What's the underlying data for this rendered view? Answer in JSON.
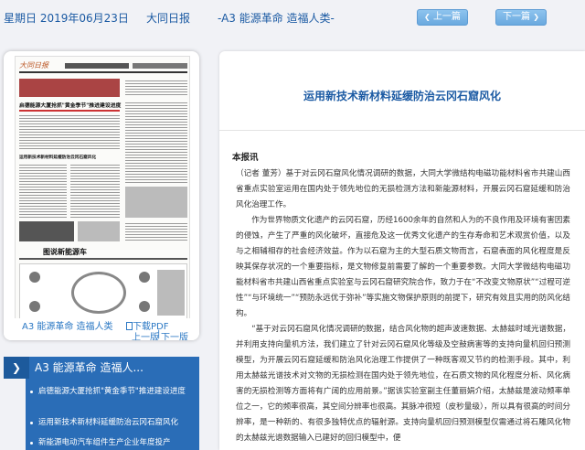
{
  "header": {
    "date": "星期日 2019年06月23日",
    "paper": "大同日报",
    "page": "-A3 能源革命 造福人类-",
    "prev_label": "上一篇",
    "next_label": "下一篇"
  },
  "thumbnail": {
    "page_label": "A3 能源革命 造福人类",
    "pdf_label": "下载PDF",
    "prev_page_label": "上一版",
    "next_page_label": "下一版",
    "headline_1": "启德能源大厦抢抓\"黄金季节\"推进建设进度",
    "headline_2": "运用新技术新材料延缓防治云冈石窟风化",
    "headline_3": "图说新能源车"
  },
  "section": {
    "title": "A3  能源革命 造福人...",
    "items": [
      "启德能源大厦抢抓\"黄金季节\"推进建设进度",
      "运用新技术新材料延缓防治云冈石窟风化",
      "新能源电动汽车组件生产企业年度投产"
    ]
  },
  "article": {
    "title": "运用新技术新材料延缓防治云冈石窟风化",
    "byline": "本报讯",
    "paragraphs": [
      "（记者 董芳）基于对云冈石窟风化情况调研的数据，大同大学微结构电磁功能材料省市共建山西省重点实验室运用在国内处于领先地位的无损检测方法和新能源材料，开展云冈石窟延缓和防治风化治理工作。",
      "作为世界物质文化遗产的云冈石窟，历经1600余年的自然和人为的不良作用及环境有害因素的侵蚀，产生了严重的风化破坏，直接危及这一优秀文化遗产的生存寿命和艺术观赏价值，以及与之相辅相存的社会经济效益。作为以石窟为主的大型石质文物而言，石窟表面的风化程度是反映其保存状况的一个重要指标，是文物修复前需要了解的一个重要参数。大同大学微结构电磁功能材料省市共建山西省重点实验室与云冈石窟研究院合作，致力于在“不改变文物原状”“过程可逆性”“与环境统一”“预防永远优于弥补”等实施文物保护原则的前提下，研究有效且实用的防风化结构。",
      "“基于对云冈石窟风化情况调研的数据，结合风化物的超声波速数据、太赫兹时域光谱数据，并利用支持向量机方法，我们建立了针对云冈石窟风化等级及空鼓病害等的支持向量机回归预测模型，为开展云冈石窟延缓和防治风化治理工作提供了一种既客观又节约的检测手段。其中，利用太赫兹光谱技术对文物的无损检测在国内处于领先地位，在石质文物的风化程度分析、风化病害的无损检测等方面将有广阔的应用前景。”据该实验室副主任董丽娟介绍，太赫兹是波动频率单位之一，它的频率很高，其空间分辨率也很高。其脉冲很短（皮秒量级），所以具有很高的时间分辨率，是一种新的、有很多独特优点的辐射源。支持向量机回归预测模型仅需通过将石雕风化物的太赫兹光谱数据输入已建好的回归模型中，便"
    ]
  }
}
